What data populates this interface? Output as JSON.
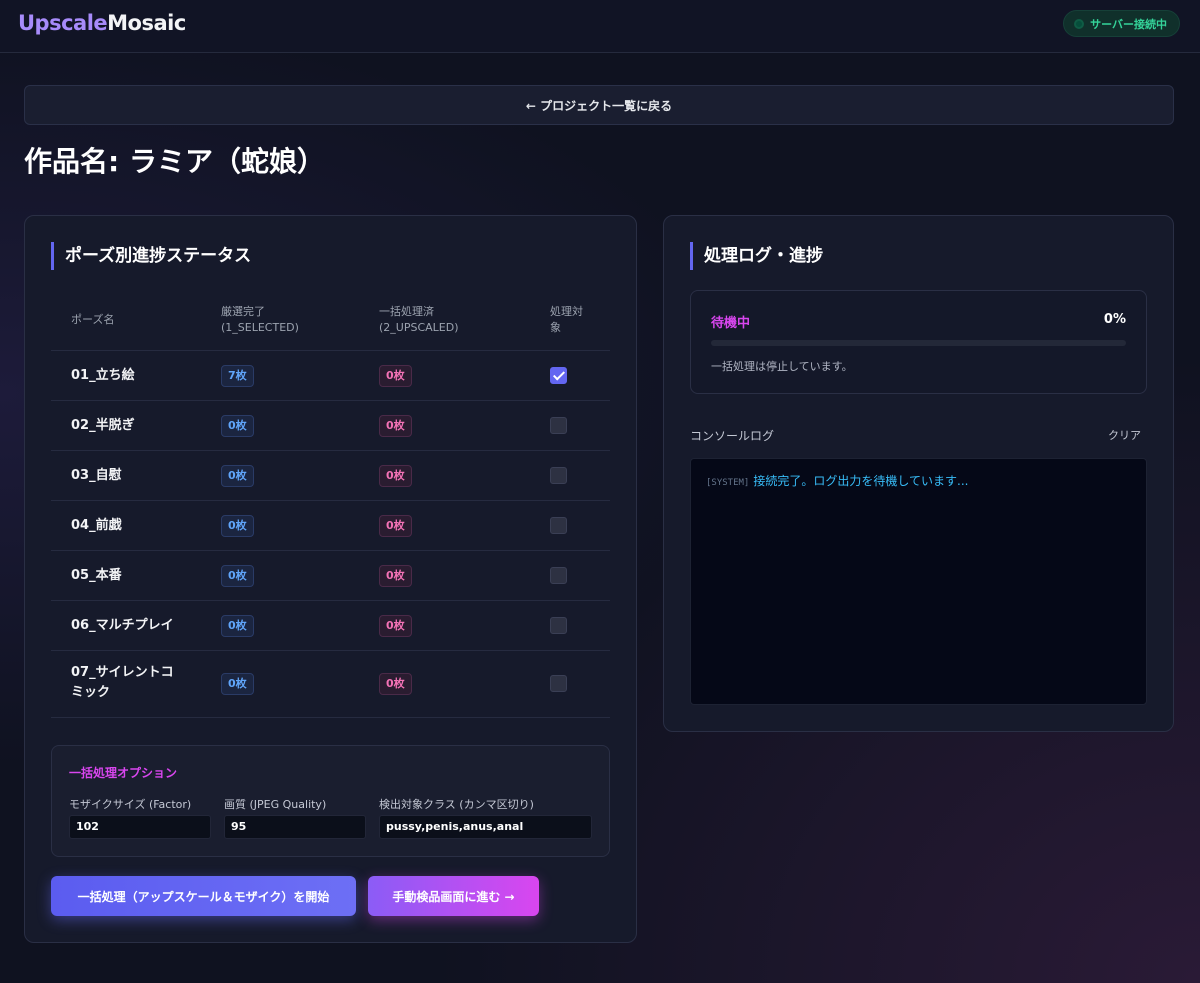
{
  "header": {
    "logo_part1": "Upscale",
    "logo_part2": "Mosaic",
    "server_status": "サーバー接続中",
    "server_status_color": "#34d399"
  },
  "nav": {
    "back_label": "← プロジェクト一覧に戻る"
  },
  "page": {
    "title": "作品名: ラミア（蛇娘）"
  },
  "pose_status": {
    "section_title": "ポーズ別進捗ステータス",
    "columns": {
      "pose_name": "ポーズ名",
      "selected_line1": "厳選完了",
      "selected_line2": "(1_SELECTED)",
      "upscaled_line1": "一括処理済",
      "upscaled_line2": "(2_UPSCALED)",
      "target_line1": "処理対",
      "target_line2": "象"
    },
    "rows": [
      {
        "name": "01_立ち絵",
        "selected": "7枚",
        "upscaled": "0枚",
        "checked": true
      },
      {
        "name": "02_半脱ぎ",
        "selected": "0枚",
        "upscaled": "0枚",
        "checked": false
      },
      {
        "name": "03_自慰",
        "selected": "0枚",
        "upscaled": "0枚",
        "checked": false
      },
      {
        "name": "04_前戯",
        "selected": "0枚",
        "upscaled": "0枚",
        "checked": false
      },
      {
        "name": "05_本番",
        "selected": "0枚",
        "upscaled": "0枚",
        "checked": false
      },
      {
        "name": "06_マルチプレイ",
        "selected": "0枚",
        "upscaled": "0枚",
        "checked": false
      },
      {
        "name_line1": "07_サイレントコ",
        "name_line2": "ミック",
        "selected": "0枚",
        "upscaled": "0枚",
        "checked": false
      }
    ]
  },
  "batch_options": {
    "title": "一括処理オプション",
    "mosaic_label": "モザイクサイズ (Factor)",
    "mosaic_value": "102",
    "quality_label": "画質 (JPEG Quality)",
    "quality_value": "95",
    "classes_label": "検出対象クラス (カンマ区切り)",
    "classes_value": "pussy,penis,anus,anal"
  },
  "actions": {
    "start_label": "一括処理（アップスケール＆モザイク）を開始",
    "next_label": "手動検品画面に進む →"
  },
  "log_panel": {
    "section_title": "処理ログ・進捗",
    "status_label": "待機中",
    "progress_text": "0%",
    "progress_value": 0,
    "status_message": "一括処理は停止しています。",
    "console_label": "コンソールログ",
    "clear_label": "クリア",
    "log_tag": "[SYSTEM]",
    "log_message": "接続完了。ログ出力を待機しています..."
  }
}
